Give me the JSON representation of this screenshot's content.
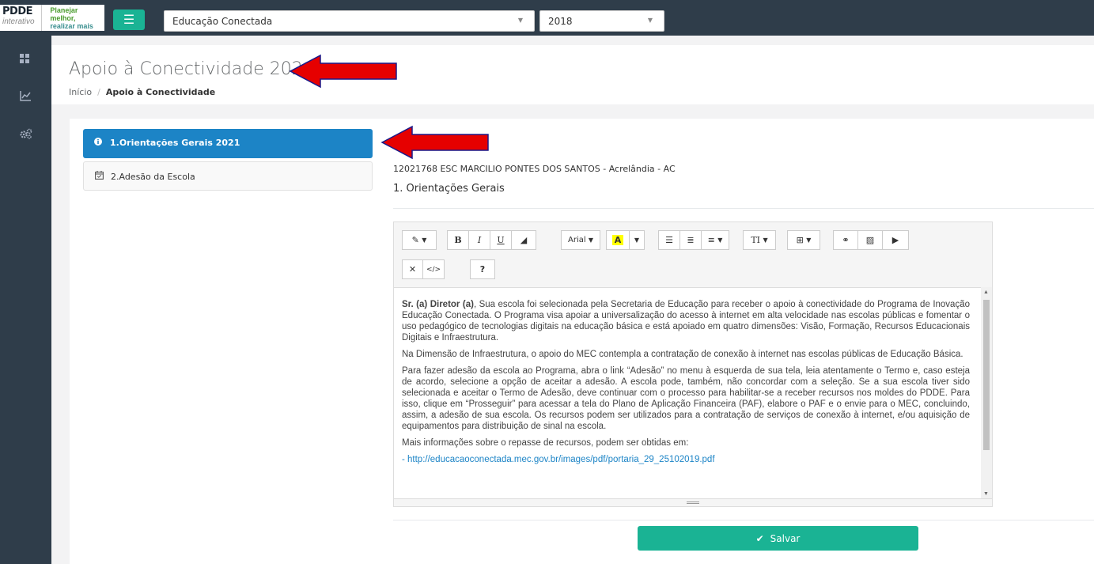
{
  "topbar": {
    "logo_main": "PDDE",
    "logo_sub": "interativo",
    "slogan_line1": "Planejar melhor,",
    "slogan_line2": "realizar mais",
    "menu_icon": "hamburger-icon",
    "program_select": "Educação Conectada",
    "year_select": "2018"
  },
  "sidebar": {
    "icons": [
      "grid-icon",
      "chart-icon",
      "gears-icon"
    ]
  },
  "header": {
    "title": "Apoio à Conectividade 2021",
    "breadcrumb_home": "Início",
    "breadcrumb_current": "Apoio à Conectividade"
  },
  "nav": {
    "items": [
      {
        "label": "1.Orientações Gerais 2021",
        "icon": "info-icon",
        "active": true
      },
      {
        "label": "2.Adesão da Escola",
        "icon": "calendar-icon",
        "active": false
      }
    ]
  },
  "main": {
    "school": "12021768 ESC MARCILIO PONTES DOS SANTOS - Acrelândia - AC",
    "section_title": "1. Orientações Gerais"
  },
  "toolbar": {
    "font_name": "Arial",
    "bold": "B",
    "italic": "I",
    "underline": "U",
    "help": "?"
  },
  "editor": {
    "p1_bold": "Sr. (a) Diretor (a)",
    "p1_rest": ", Sua escola foi selecionada pela Secretaria de Educação para receber o apoio à conectividade do Programa de Inovação Educação Conectada. O Programa visa apoiar a universalização do acesso à internet em alta velocidade nas escolas públicas e fomentar o uso pedagógico de tecnologias digitais na educação básica e está apoiado em quatro dimensões: Visão, Formação, Recursos Educacionais Digitais e Infraestrutura.",
    "p2": "Na Dimensão de Infraestrutura, o apoio do MEC contempla a contratação de conexão à internet nas escolas públicas de Educação Básica.",
    "p3": "Para fazer adesão da escola ao Programa, abra o link “Adesão” no menu à esquerda de sua tela, leia atentamente o Termo e, caso esteja de acordo, selecione a opção de aceitar a adesão. A escola pode, também, não concordar com a seleção. Se a sua escola tiver sido selecionada e aceitar o Termo de Adesão, deve continuar com o processo para habilitar-se a receber recursos nos moldes do PDDE. Para isso, clique em “Prosseguir” para acessar a tela do Plano de Aplicação Financeira (PAF), elabore o PAF e o envie para o MEC, concluindo, assim, a adesão de sua escola. Os recursos podem ser utilizados para a contratação de serviços de conexão à internet, e/ou aquisição de equipamentos para distribuição de sinal na escola.",
    "p4": "Mais informações sobre o repasse de recursos, podem ser obtidas em:",
    "p5": "- http://educacaoconectada.mec.gov.br/images/pdf/portaria_29_25102019.pdf"
  },
  "save_label": "Salvar",
  "colors": {
    "topbar": "#2f3d4a",
    "accent_green": "#1ab394",
    "active_blue": "#1c84c6",
    "annotation_red": "#e60000"
  }
}
